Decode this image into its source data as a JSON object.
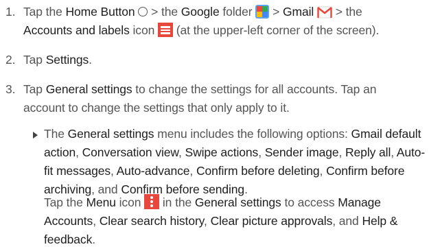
{
  "steps": [
    {
      "num": "1.",
      "tap": "Tap the",
      "home": "Home Button",
      "gt1": ">",
      "the1": "the",
      "google": "Google",
      "folder": "folder",
      "gt2": ">",
      "gmail": "Gmail",
      "gt3": "> the",
      "accounts": "Accounts and labels",
      "icon_word": "icon",
      "tail": "(at the upper-left corner of the screen)."
    },
    {
      "num": "2.",
      "tap": "Tap",
      "settings": "Settings",
      "end": "."
    },
    {
      "num": "3.",
      "tap": "Tap",
      "general": "General settings",
      "rest1": "to change the settings for all accounts. Tap an",
      "rest2": "account to change the settings that only apply to it."
    }
  ],
  "bullet": {
    "the": "The",
    "general": "General settings",
    "menu_includes": "menu includes the following options:",
    "gmail_default": "Gmail default action",
    "conversation": "Conversation view",
    "swipe": "Swipe actions",
    "sender": "Sender image",
    "reply": "Reply all",
    "autofit": "Auto-fit messages",
    "autoadv": "Auto-advance",
    "confirm_del": "Confirm before deleting",
    "confirm_arch": "Confirm before archiving",
    "and": "and",
    "confirm_send": "Confirm before sending",
    "end": "."
  },
  "para": {
    "tap_the": "Tap the",
    "menu": "Menu",
    "icon_in": "icon",
    "in_the": "in the",
    "general": "General settings",
    "to_access": "to access",
    "manage": "Manage Accounts",
    "clear_search": "Clear search history",
    "clear_pic": "Clear picture approvals",
    "and": "and",
    "help": "Help & feedback",
    "end": "."
  },
  "icons": [
    "circle-icon",
    "folder-icon",
    "gmail-icon",
    "menu-icon",
    "vertical-dots-icon"
  ],
  "colors": {
    "text": "#555555",
    "emphasis": "#1e1e1e",
    "icon_red": "#e8483b"
  }
}
